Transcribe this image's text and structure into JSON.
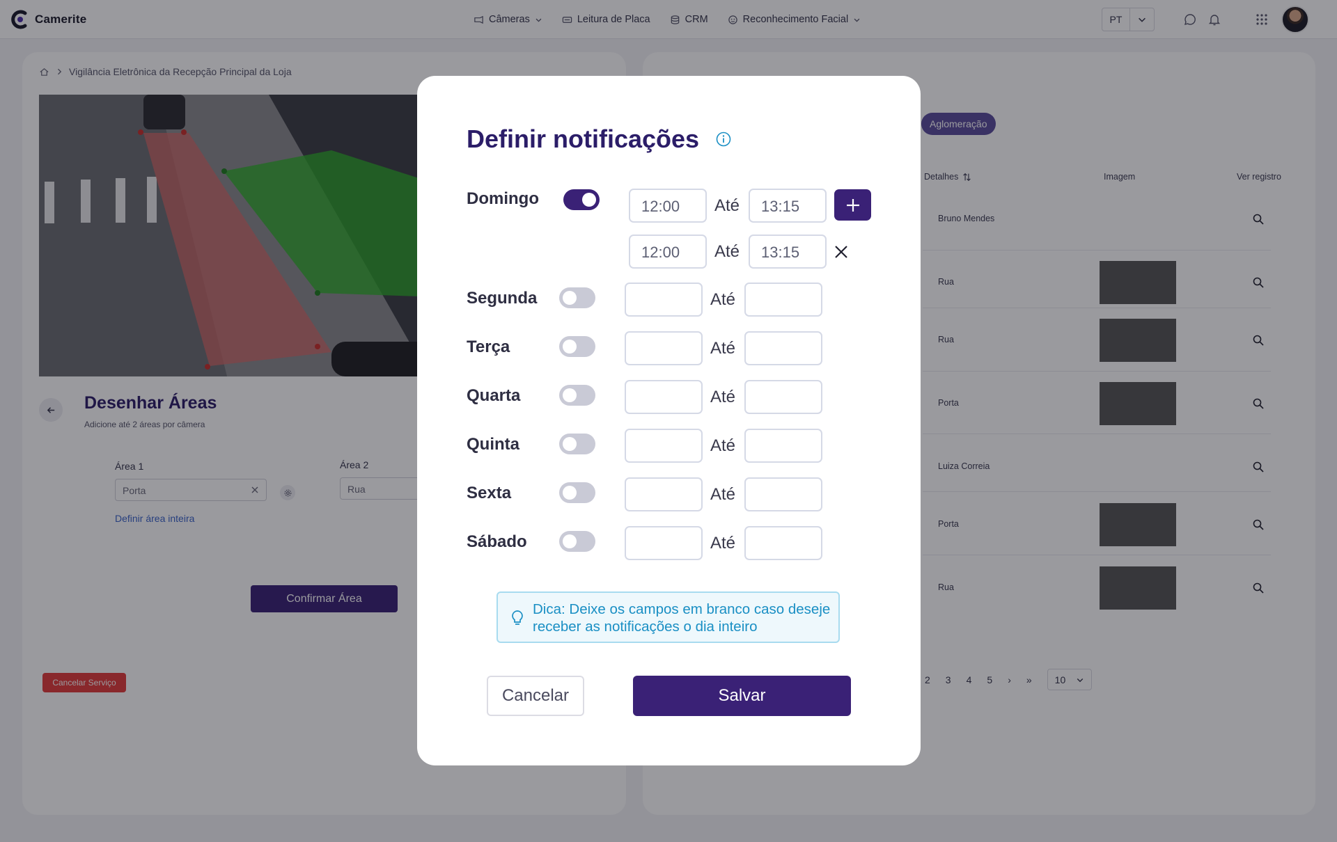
{
  "app": {
    "name": "Camerite",
    "brand_color": "#3a2176",
    "accent_color": "#1a8fc4"
  },
  "nav": {
    "items": [
      {
        "label": "Câmeras",
        "icon": "camera-icon",
        "has_dropdown": true
      },
      {
        "label": "Leitura de Placa",
        "icon": "plate-icon",
        "has_dropdown": false
      },
      {
        "label": "CRM",
        "icon": "database-icon",
        "has_dropdown": false
      },
      {
        "label": "Reconhecimento Facial",
        "icon": "face-icon",
        "has_dropdown": true
      }
    ],
    "language": "PT"
  },
  "left_panel": {
    "breadcrumb": "Vigilância Eletrônica da Recepção Principal da Loja",
    "draw_title": "Desenhar Áreas",
    "draw_subtitle": "Adicione até 2 áreas por câmera",
    "area1_label": "Área 1",
    "area1_value": "Porta",
    "area2_label": "Área 2",
    "area2_value": "Rua",
    "define_whole_area": "Definir área inteira",
    "confirm_button": "Confirmar Área",
    "cancel_service_button": "Cancelar Serviço"
  },
  "right_panel": {
    "chip": "Aglomeração",
    "columns": {
      "details": "Detalhes",
      "image": "Imagem",
      "view": "Ver registro"
    },
    "rows": [
      {
        "details": "Bruno Mendes",
        "has_image": false
      },
      {
        "details": "Rua",
        "has_image": true
      },
      {
        "details": "Rua",
        "has_image": true
      },
      {
        "details": "Porta",
        "has_image": true
      },
      {
        "details": "Luiza Correia",
        "has_image": false
      },
      {
        "details": "Porta",
        "has_image": true
      },
      {
        "details": "Rua",
        "has_image": true
      }
    ],
    "pagination": {
      "pages": [
        "2",
        "3",
        "4",
        "5"
      ],
      "next": "›",
      "last": "»",
      "per_page": "10"
    }
  },
  "modal": {
    "title": "Definir notificações",
    "until_label": "Até",
    "days": [
      {
        "name": "Domingo",
        "enabled": true,
        "ranges": [
          {
            "from": "12:00",
            "to": "13:15"
          },
          {
            "from": "12:00",
            "to": "13:15"
          }
        ]
      },
      {
        "name": "Segunda",
        "enabled": false,
        "from": "",
        "to": ""
      },
      {
        "name": "Terça",
        "enabled": false,
        "from": "",
        "to": ""
      },
      {
        "name": "Quarta",
        "enabled": false,
        "from": "",
        "to": ""
      },
      {
        "name": "Quinta",
        "enabled": false,
        "from": "",
        "to": ""
      },
      {
        "name": "Sexta",
        "enabled": false,
        "from": "",
        "to": ""
      },
      {
        "name": "Sábado",
        "enabled": false,
        "from": "",
        "to": ""
      }
    ],
    "tip": "Dica: Deixe os campos em branco caso deseje receber as notificações o dia inteiro",
    "cancel_button": "Cancelar",
    "save_button": "Salvar"
  }
}
